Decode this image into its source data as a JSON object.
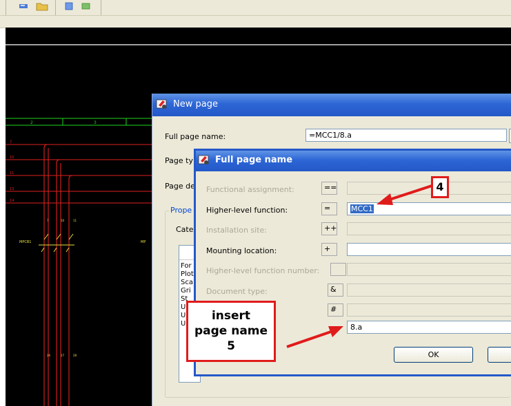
{
  "toolbar": {
    "buttons": [
      "blue-arrow-icon",
      "folder-icon",
      "blue-doc-icon",
      "green-doc-icon"
    ]
  },
  "drawing": {
    "column_numbers": [
      "2",
      "3"
    ],
    "row_numbers": [
      "7",
      "10",
      "11",
      "13",
      "14"
    ],
    "component_tag_left": "MPCB1",
    "component_tag_right": "MP",
    "terminal_top": [
      "7",
      "10",
      "11"
    ],
    "terminal_bottom": [
      "26",
      "27",
      "28"
    ]
  },
  "new_page_dialog": {
    "title": "New page",
    "full_page_name_label": "Full page name:",
    "full_page_name_value": "=MCC1/8.a",
    "page_type_label": "Page ty",
    "page_desc_label": "Page de",
    "properties_label": "Prope",
    "category_label": "Cate",
    "list_items": [
      "For",
      "Plot",
      "Sca",
      "Gri",
      "St",
      "U",
      "U",
      "U"
    ]
  },
  "full_name_dialog": {
    "title": "Full page name",
    "fields": [
      {
        "label": "Functional assignment:",
        "prefix": "==",
        "value": "",
        "enabled": false
      },
      {
        "label": "Higher-level function:",
        "prefix": "=",
        "value": "MCC1",
        "enabled": true
      },
      {
        "label": "Installation site:",
        "prefix": "++",
        "value": "",
        "enabled": false
      },
      {
        "label": "Mounting location:",
        "prefix": "+",
        "value": "",
        "enabled": true
      },
      {
        "label": "Higher-level function number:",
        "prefix": "",
        "value": "",
        "enabled": false
      },
      {
        "label": "Document type:",
        "prefix": "&",
        "value": "",
        "enabled": false
      },
      {
        "label": "",
        "prefix": "#",
        "value": "",
        "enabled": false
      },
      {
        "label": "",
        "prefix": "",
        "value": "8.a",
        "enabled": true
      }
    ],
    "ok_label": "OK"
  },
  "annotations": {
    "step4": "4",
    "step5_line1": "insert",
    "step5_line2": "page name",
    "step5_line3": "5",
    "color": "#e01b1b"
  }
}
